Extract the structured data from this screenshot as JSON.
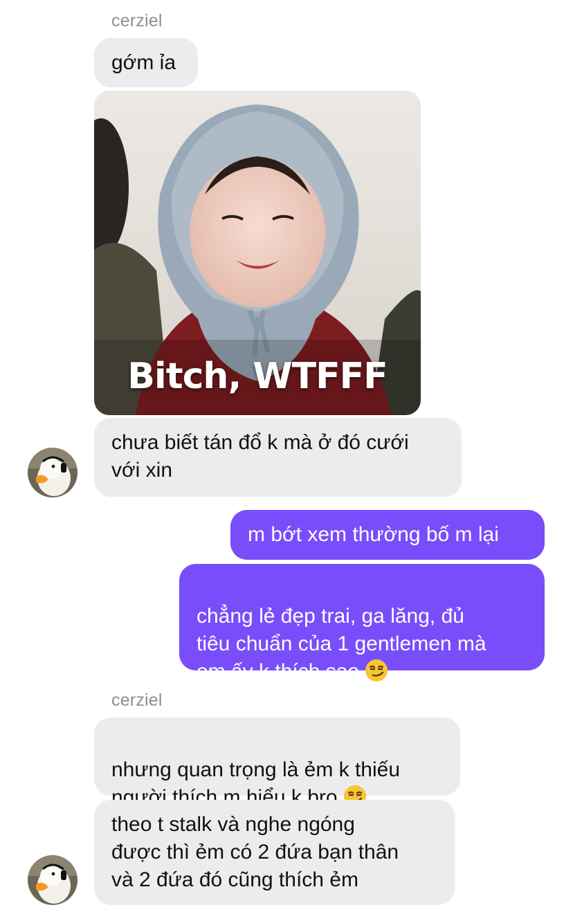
{
  "conversation": {
    "group1": {
      "sender_name": "cerziel",
      "msg1": "gớm ỉa",
      "image_caption": "Bitch, WTFFF",
      "msg2": "chưa biết tán đổ k mà ở đó cưới\nvới xin"
    },
    "outgoing": {
      "msg1": "m bớt xem thường bố m lại",
      "msg2": "chẳng lẻ đẹp trai, ga lăng, đủ\ntiêu chuẩn của 1 gentlemen mà\nem ấy k thích sao"
    },
    "group2": {
      "sender_name": "cerziel",
      "msg1": "nhưng quan trọng là ẻm k thiếu\nngười thích m hiểu k bro",
      "msg2": "theo t stalk và nghe ngóng\nđược thì ẻm có 2 đứa bạn thân\nvà 2 đứa đó cũng thích ẻm"
    }
  },
  "icons": {
    "reaction_emoji": "smirking-face-emoji",
    "avatar": "duck-avatar"
  },
  "colors": {
    "incoming_bubble": "#ececef",
    "outgoing_bubble": "#7a4dfa",
    "sender_name": "#8e8e93",
    "emoji": "#f7c531"
  }
}
